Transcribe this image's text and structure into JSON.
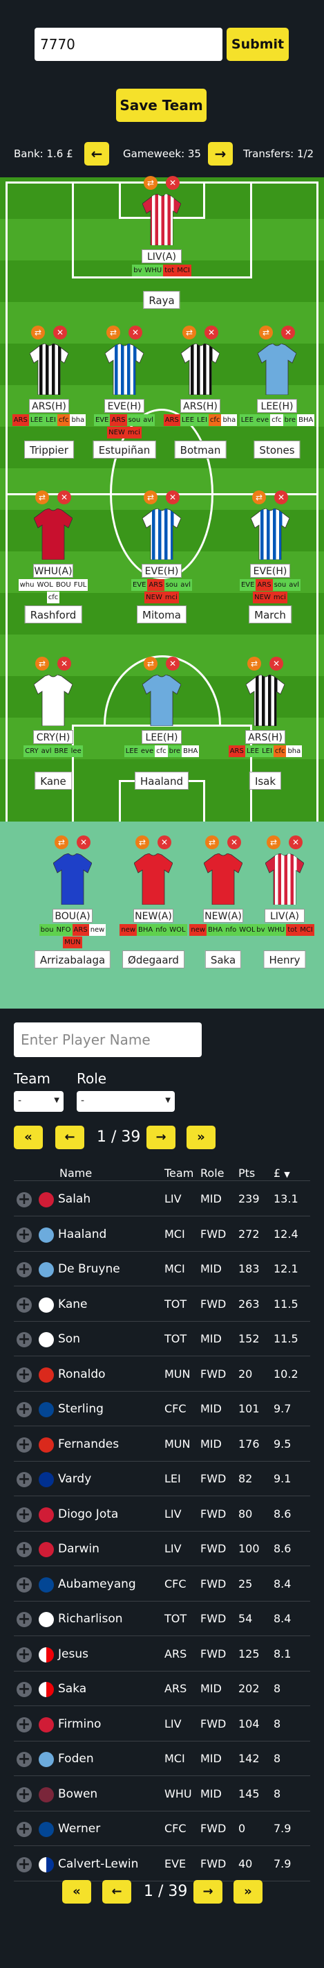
{
  "header": {
    "team_input_value": "7770",
    "submit_label": "Submit",
    "save_label": "Save Team"
  },
  "bar": {
    "bank": "Bank: 1.6 £",
    "prev": "←",
    "gameweek": "Gameweek: 35",
    "next": "→",
    "transfers": "Transfers: 1/2"
  },
  "icons": {
    "swap": "⇄",
    "remove": "✕",
    "add": "+"
  },
  "colors": {
    "accent": "#f5e12a",
    "pitch": "#3a961a",
    "bench": "#71c898",
    "fixture_easy": "#5fd14e",
    "fixture_hard": "#e63021",
    "fixture_medium": "#f06a19",
    "swap": "#ed7d17",
    "remove": "#e03434"
  },
  "squad": [
    {
      "name": "Raya",
      "club": "LIV(A)",
      "kit": "liv",
      "fixtures": [
        [
          "bv",
          "g"
        ],
        [
          "WHU",
          "g"
        ],
        [
          "tot",
          "r"
        ],
        [
          "MCI",
          "r"
        ]
      ]
    },
    {
      "name": "Trippier",
      "club": "ARS(H)",
      "kit": "new",
      "fixtures": [
        [
          "ARS",
          "r"
        ],
        [
          "LEE",
          "g"
        ],
        [
          "LEI",
          "g"
        ],
        [
          "cfc",
          "o"
        ],
        [
          "bha",
          "w"
        ]
      ]
    },
    {
      "name": "Estupiñan",
      "club": "EVE(H)",
      "kit": "bha",
      "fixtures": [
        [
          "EVE",
          "g"
        ],
        [
          "ARS",
          "r"
        ],
        [
          "sou",
          "g"
        ],
        [
          "avl",
          "g"
        ],
        [
          "NEW",
          "r"
        ],
        [
          "mci",
          "r"
        ]
      ]
    },
    {
      "name": "Botman",
      "club": "ARS(H)",
      "kit": "new",
      "fixtures": [
        [
          "ARS",
          "r"
        ],
        [
          "LEE",
          "g"
        ],
        [
          "LEI",
          "g"
        ],
        [
          "cfc",
          "o"
        ],
        [
          "bha",
          "w"
        ]
      ]
    },
    {
      "name": "Stones",
      "club": "LEE(H)",
      "kit": "mci",
      "fixtures": [
        [
          "LEE",
          "g"
        ],
        [
          "eve",
          "g"
        ],
        [
          "cfc",
          "w"
        ],
        [
          "bre",
          "g"
        ],
        [
          "BHA",
          "w"
        ]
      ]
    },
    {
      "name": "Rashford",
      "club": "WHU(A)",
      "kit": "mun",
      "fixtures": [
        [
          "whu",
          "w"
        ],
        [
          "WOL",
          "w"
        ],
        [
          "BOU",
          "w"
        ],
        [
          "FUL",
          "w"
        ],
        [
          "cfc",
          "w"
        ]
      ]
    },
    {
      "name": "Mitoma",
      "club": "EVE(H)",
      "kit": "bha",
      "fixtures": [
        [
          "EVE",
          "g"
        ],
        [
          "ARS",
          "r"
        ],
        [
          "sou",
          "g"
        ],
        [
          "avl",
          "g"
        ],
        [
          "NEW",
          "r"
        ],
        [
          "mci",
          "r"
        ]
      ]
    },
    {
      "name": "March",
      "club": "EVE(H)",
      "kit": "bha",
      "fixtures": [
        [
          "EVE",
          "g"
        ],
        [
          "ARS",
          "r"
        ],
        [
          "sou",
          "g"
        ],
        [
          "avl",
          "g"
        ],
        [
          "NEW",
          "r"
        ],
        [
          "mci",
          "r"
        ]
      ]
    },
    {
      "name": "Kane",
      "club": "CRY(H)",
      "kit": "tot",
      "fixtures": [
        [
          "CRY",
          "g"
        ],
        [
          "avl",
          "g"
        ],
        [
          "BRE",
          "g"
        ],
        [
          "lee",
          "g"
        ]
      ]
    },
    {
      "name": "Haaland",
      "club": "LEE(H)",
      "kit": "mci",
      "fixtures": [
        [
          "LEE",
          "g"
        ],
        [
          "eve",
          "g"
        ],
        [
          "cfc",
          "w"
        ],
        [
          "bre",
          "g"
        ],
        [
          "BHA",
          "w"
        ]
      ]
    },
    {
      "name": "Isak",
      "club": "ARS(H)",
      "kit": "new",
      "fixtures": [
        [
          "ARS",
          "r"
        ],
        [
          "LEE",
          "g"
        ],
        [
          "LEI",
          "g"
        ],
        [
          "cfc",
          "o"
        ],
        [
          "bha",
          "w"
        ]
      ]
    }
  ],
  "bench": [
    {
      "name": "Arrizabalaga",
      "club": "BOU(A)",
      "kit": "cfc",
      "fixtures": [
        [
          "bou",
          "g"
        ],
        [
          "NFO",
          "g"
        ],
        [
          "ARS",
          "r"
        ],
        [
          "new",
          "w"
        ],
        [
          "MUN",
          "r"
        ]
      ]
    },
    {
      "name": "Ødegaard",
      "club": "NEW(A)",
      "kit": "ars",
      "fixtures": [
        [
          "new",
          "r"
        ],
        [
          "BHA",
          "g"
        ],
        [
          "nfo",
          "g"
        ],
        [
          "WOL",
          "g"
        ]
      ]
    },
    {
      "name": "Saka",
      "club": "NEW(A)",
      "kit": "ars",
      "fixtures": [
        [
          "new",
          "r"
        ],
        [
          "BHA",
          "g"
        ],
        [
          "nfo",
          "g"
        ],
        [
          "WOL",
          "g"
        ]
      ]
    },
    {
      "name": "Henry",
      "club": "LIV(A)",
      "kit": "liv",
      "fixtures": [
        [
          "bv",
          "g"
        ],
        [
          "WHU",
          "g"
        ],
        [
          "tot",
          "r"
        ],
        [
          "MCI",
          "r"
        ]
      ]
    }
  ],
  "filters": {
    "search_placeholder": "Enter Player Name",
    "team_label": "Team",
    "role_label": "Role",
    "team_value": "-",
    "role_value": "-"
  },
  "pagination": {
    "first": "«",
    "prev": "←",
    "page_text": "1 / 39",
    "next": "→",
    "last": "»"
  },
  "table": {
    "headers": {
      "name": "Name",
      "team": "Team",
      "role": "Role",
      "pts": "Pts",
      "price": "£",
      "sort_indicator": "▼"
    },
    "rows": [
      {
        "name": "Salah",
        "team": "LIV",
        "role": "MID",
        "pts": "239",
        "price": "13.1",
        "color": "#d01c36"
      },
      {
        "name": "Haaland",
        "team": "MCI",
        "role": "FWD",
        "pts": "272",
        "price": "12.4",
        "color": "#6cabdd"
      },
      {
        "name": "De Bruyne",
        "team": "MCI",
        "role": "MID",
        "pts": "183",
        "price": "12.1",
        "color": "#6cabdd"
      },
      {
        "name": "Kane",
        "team": "TOT",
        "role": "FWD",
        "pts": "263",
        "price": "11.5",
        "color": "#ffffff"
      },
      {
        "name": "Son",
        "team": "TOT",
        "role": "MID",
        "pts": "152",
        "price": "11.5",
        "color": "#ffffff"
      },
      {
        "name": "Ronaldo",
        "team": "MUN",
        "role": "FWD",
        "pts": "20",
        "price": "10.2",
        "color": "#da291c"
      },
      {
        "name": "Sterling",
        "team": "CFC",
        "role": "MID",
        "pts": "101",
        "price": "9.7",
        "color": "#034694"
      },
      {
        "name": "Fernandes",
        "team": "MUN",
        "role": "MID",
        "pts": "176",
        "price": "9.5",
        "color": "#da291c"
      },
      {
        "name": "Vardy",
        "team": "LEI",
        "role": "FWD",
        "pts": "82",
        "price": "9.1",
        "color": "#003090"
      },
      {
        "name": "Diogo Jota",
        "team": "LIV",
        "role": "FWD",
        "pts": "80",
        "price": "8.6",
        "color": "#d01c36"
      },
      {
        "name": "Darwin",
        "team": "LIV",
        "role": "FWD",
        "pts": "100",
        "price": "8.6",
        "color": "#d01c36"
      },
      {
        "name": "Aubameyang",
        "team": "CFC",
        "role": "FWD",
        "pts": "25",
        "price": "8.4",
        "color": "#034694"
      },
      {
        "name": "Richarlison",
        "team": "TOT",
        "role": "FWD",
        "pts": "54",
        "price": "8.4",
        "color": "#ffffff"
      },
      {
        "name": "Jesus",
        "team": "ARS",
        "role": "FWD",
        "pts": "125",
        "price": "8.1",
        "color": "#ef0107",
        "half": true
      },
      {
        "name": "Saka",
        "team": "ARS",
        "role": "MID",
        "pts": "202",
        "price": "8",
        "color": "#ef0107",
        "half": true
      },
      {
        "name": "Firmino",
        "team": "LIV",
        "role": "FWD",
        "pts": "104",
        "price": "8",
        "color": "#d01c36"
      },
      {
        "name": "Foden",
        "team": "MCI",
        "role": "MID",
        "pts": "142",
        "price": "8",
        "color": "#6cabdd"
      },
      {
        "name": "Bowen",
        "team": "WHU",
        "role": "MID",
        "pts": "145",
        "price": "8",
        "color": "#7a263a"
      },
      {
        "name": "Werner",
        "team": "CFC",
        "role": "FWD",
        "pts": "0",
        "price": "7.9",
        "color": "#034694"
      },
      {
        "name": "Calvert-Lewin",
        "team": "EVE",
        "role": "FWD",
        "pts": "40",
        "price": "7.9",
        "color": "#003399",
        "half": true
      }
    ]
  }
}
